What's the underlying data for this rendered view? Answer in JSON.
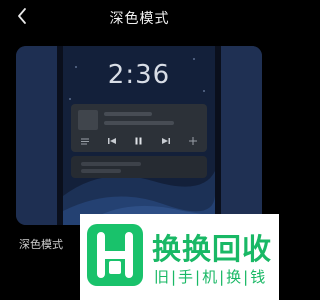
{
  "header": {
    "title": "深色模式",
    "back_icon": "chevron-left-icon"
  },
  "preview": {
    "clock": "2:36",
    "music_controls": [
      "list-icon",
      "previous-icon",
      "pause-icon",
      "next-icon",
      "plus-icon"
    ]
  },
  "settings": {
    "dark_mode_label": "深色模式"
  },
  "watermark": {
    "brand": "换换回收",
    "tagline": "旧|手|机|换|钱",
    "logo_letter": "H",
    "color": "#19c26b"
  },
  "colors": {
    "background": "#000000",
    "preview_blue": "#1b2a48",
    "card": "#2c3138"
  }
}
